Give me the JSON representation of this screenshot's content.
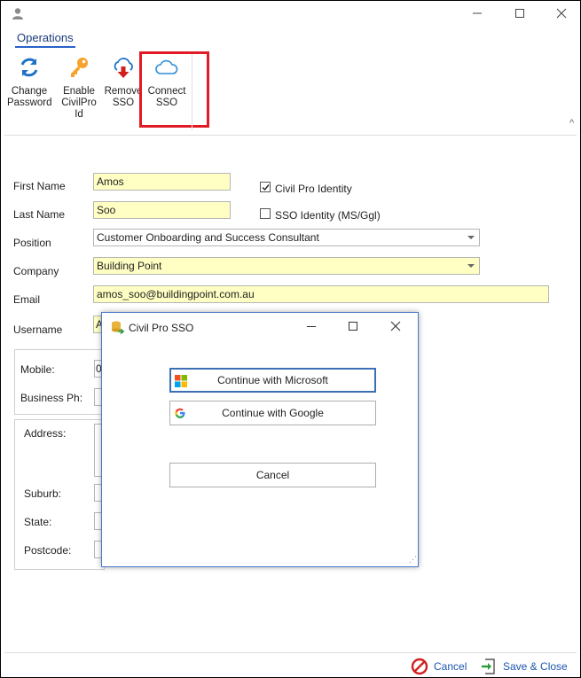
{
  "window": {
    "icon": "user-icon",
    "controls": {
      "minimize": "minimize-icon",
      "maximize": "maximize-icon",
      "close": "close-icon"
    }
  },
  "ribbon": {
    "tab": "Operations",
    "buttons": [
      {
        "label1": "Change",
        "label2": "Password",
        "icon": "refresh-icon"
      },
      {
        "label1": "Enable",
        "label2": "CivilPro Id",
        "icon": "key-icon"
      },
      {
        "label1": "Remove",
        "label2": "SSO",
        "icon": "cloud-remove-icon"
      },
      {
        "label1": "Connect",
        "label2": "SSO",
        "icon": "cloud-icon"
      }
    ],
    "highlight_color": "#e01b24"
  },
  "form": {
    "first_name": {
      "label": "First Name",
      "value": "Amos"
    },
    "last_name": {
      "label": "Last Name",
      "value": "Soo"
    },
    "position": {
      "label": "Position",
      "value": "Customer Onboarding and Success Consultant"
    },
    "company": {
      "label": "Company",
      "value": "Building Point"
    },
    "email": {
      "label": "Email",
      "value": "amos_soo@buildingpoint.com.au"
    },
    "username": {
      "label": "Username",
      "value": "A"
    },
    "civilpro_identity": {
      "label": "Civil Pro Identity",
      "checked": true
    },
    "sso_identity": {
      "label": "SSO Identity (MS/Ggl)",
      "checked": false
    },
    "mobile": {
      "label": "Mobile:",
      "value": "0"
    },
    "business_phone": {
      "label": "Business Ph:"
    },
    "address": {
      "label": "Address:"
    },
    "suburb": {
      "label": "Suburb:"
    },
    "state": {
      "label": "State:"
    },
    "postcode": {
      "label": "Postcode:"
    },
    "field_bg": "#ffffc4"
  },
  "modal": {
    "title": "Civil Pro SSO",
    "microsoft_button": "Continue with Microsoft",
    "google_button": "Continue with Google",
    "cancel_button": "Cancel",
    "border_color": "#4a79c9"
  },
  "footer": {
    "cancel": "Cancel",
    "save_close": "Save & Close",
    "link_color": "#1c56b0"
  }
}
